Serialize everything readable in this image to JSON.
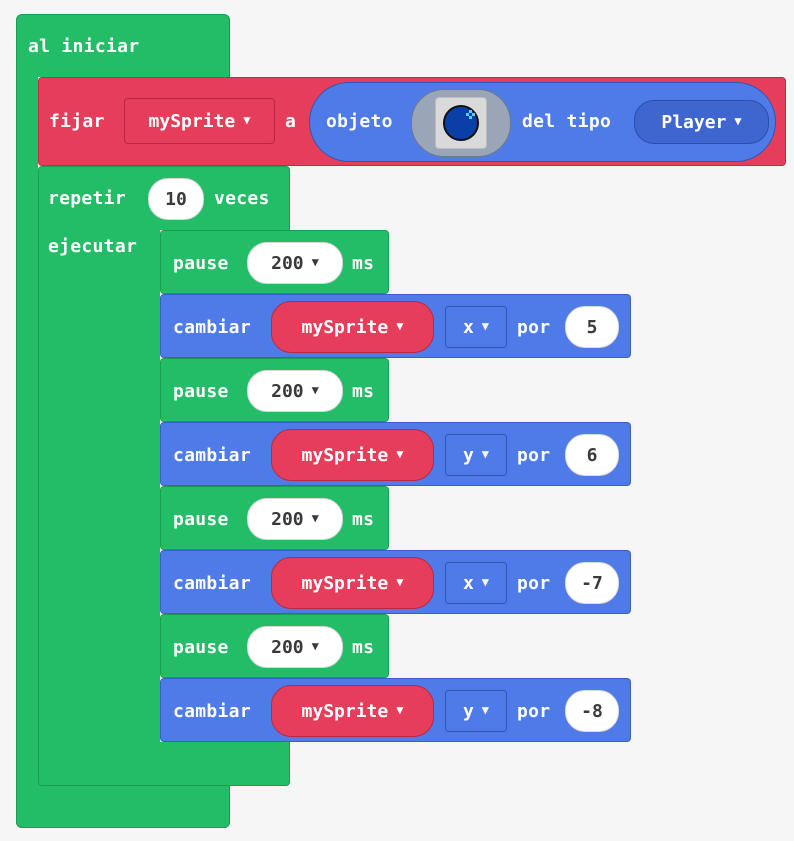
{
  "event": {
    "label": "al iniciar"
  },
  "set_block": {
    "label": "fijar",
    "variable": "mySprite",
    "to": "a",
    "sprite_label": "objeto",
    "kind_label": "del tipo",
    "kind_value": "Player",
    "image_icon": "blue-circle-sprite-icon"
  },
  "repeat_block": {
    "label": "repetir",
    "count": "10",
    "times_label": "veces",
    "do_label": "ejecutar"
  },
  "steps": [
    {
      "type": "pause",
      "label": "pause",
      "value": "200",
      "unit": "ms"
    },
    {
      "type": "change",
      "label": "cambiar",
      "variable": "mySprite",
      "axis": "x",
      "by": "por",
      "value": "5"
    },
    {
      "type": "pause",
      "label": "pause",
      "value": "200",
      "unit": "ms"
    },
    {
      "type": "change",
      "label": "cambiar",
      "variable": "mySprite",
      "axis": "y",
      "by": "por",
      "value": "6"
    },
    {
      "type": "pause",
      "label": "pause",
      "value": "200",
      "unit": "ms"
    },
    {
      "type": "change",
      "label": "cambiar",
      "variable": "mySprite",
      "axis": "x",
      "by": "por",
      "value": "-7"
    },
    {
      "type": "pause",
      "label": "pause",
      "value": "200",
      "unit": "ms"
    },
    {
      "type": "change",
      "label": "cambiar",
      "variable": "mySprite",
      "axis": "y",
      "by": "por",
      "value": "-8"
    }
  ],
  "colors": {
    "loops_green": "#23bd68",
    "sprites_blue": "#4e7be8",
    "variables_red": "#e63d5a",
    "background": "#f6f6f6"
  }
}
